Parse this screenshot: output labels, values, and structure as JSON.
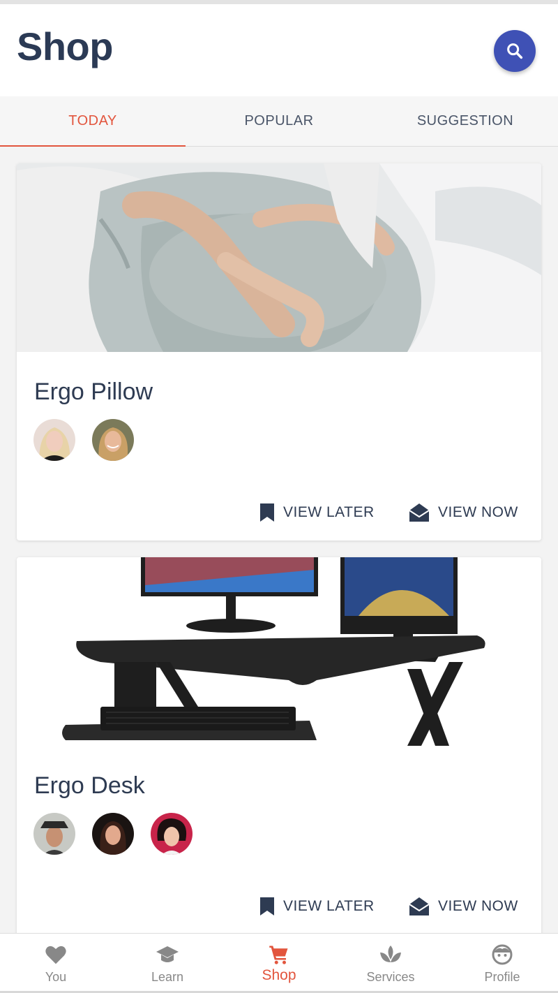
{
  "header": {
    "title": "Shop"
  },
  "tabs": [
    {
      "label": "TODAY",
      "active": true
    },
    {
      "label": "POPULAR",
      "active": false
    },
    {
      "label": "SUGGESTION",
      "active": false
    }
  ],
  "cards": [
    {
      "title": "Ergo Pillow",
      "image": "pregnant-woman-resting-on-pillow",
      "avatars": [
        "avatar-blonde-woman",
        "avatar-smiling-woman"
      ],
      "actions": {
        "later": "VIEW LATER",
        "now": "VIEW NOW"
      }
    },
    {
      "title": "Ergo Desk",
      "image": "standing-desk-with-monitors",
      "avatars": [
        "avatar-man-hat",
        "avatar-woman-dark-hair",
        "avatar-woman-curly-hair"
      ],
      "actions": {
        "later": "VIEW LATER",
        "now": "VIEW NOW"
      }
    }
  ],
  "bottom_nav": [
    {
      "label": "You",
      "icon": "heart-icon"
    },
    {
      "label": "Learn",
      "icon": "graduation-cap-icon"
    },
    {
      "label": "Shop",
      "icon": "cart-icon",
      "active": true
    },
    {
      "label": "Services",
      "icon": "lotus-icon"
    },
    {
      "label": "Profile",
      "icon": "face-icon"
    }
  ],
  "colors": {
    "accent": "#e2553d",
    "primary": "#3f51b5",
    "text": "#2e3b52"
  }
}
